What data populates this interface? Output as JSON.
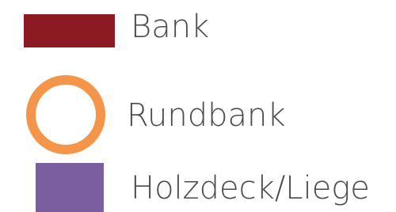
{
  "legend": {
    "items": [
      {
        "label": "Bank",
        "shape": "rectangle",
        "color": "#8b1a22"
      },
      {
        "label": "Rundbank",
        "shape": "ring",
        "color": "#f5954a"
      },
      {
        "label": "Holzdeck/Liege",
        "shape": "square",
        "color": "#7b5ea0"
      }
    ],
    "text_color": "#4a4a4a"
  }
}
